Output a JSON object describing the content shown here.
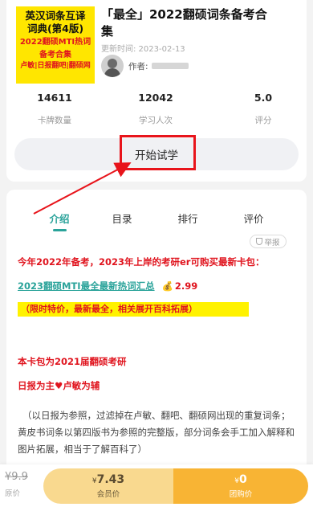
{
  "book": {
    "cover_lines": [
      "英汉词条互译",
      "词典(第4版)",
      "2022翻硕MTI热词",
      "备考合集",
      "卢敏|日报翻吧|翻硕网"
    ],
    "title": "「最全」2022翻硕词条备考合集",
    "update_label": "更新时间: 2023-02-13",
    "author_label": "作者:"
  },
  "stats": [
    {
      "value": "14611",
      "label": "卡牌数量"
    },
    {
      "value": "12042",
      "label": "学习人次"
    },
    {
      "value": "5.0",
      "label": "评分"
    }
  ],
  "trial_button": "开始试学",
  "tabs": [
    "介绍",
    "目录",
    "排行",
    "评价"
  ],
  "report_label": "举报",
  "intro": {
    "line1": "今年2022年备考，2023年上岸的考研er可购买最新卡包：",
    "link_text": "2023翻硕MTI最全最新热词汇总",
    "bag_icon": "💰",
    "link_price": "2.99",
    "highlight": "（限时特价，最新最全，相关展开百科拓展）",
    "line2": "本卡包为2021届翻硕考研",
    "line3_a": "日报为主",
    "line3_heart": "♥",
    "line3_b": "卢敏为辅",
    "paragraph": "（以日报为参照，过滤掉在卢敏、翻吧、翻硕网出现的重复词条；黄皮书词条以第四版书为参照的完整版，部分词条会手工加入解释和图片拓展，相当于了解百科了）"
  },
  "bottom": {
    "original_price": "¥9.9",
    "original_label": "原价",
    "member_currency": "¥",
    "member_price": "7.43",
    "member_label": "会员价",
    "group_currency": "¥",
    "group_price": "0",
    "group_label": "团购价"
  },
  "colors": {
    "accent": "#2aa39a",
    "red": "#e0141e",
    "cover_yellow": "#ffe600",
    "member": "#f9d98f",
    "group": "#f8b434"
  }
}
